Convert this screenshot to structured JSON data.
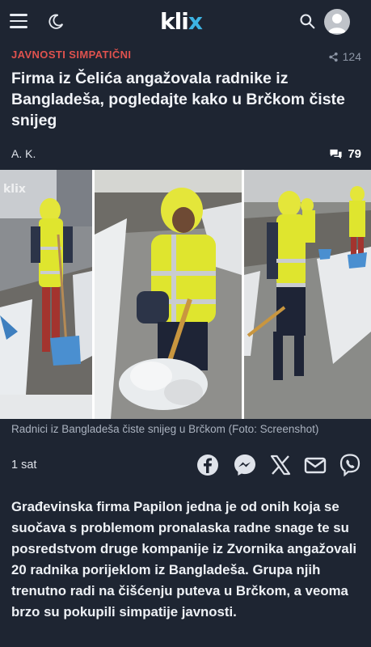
{
  "header": {
    "logo_text": "klix",
    "icons": [
      "hamburger-menu-icon",
      "moon-icon",
      "search-icon",
      "user-avatar-icon"
    ]
  },
  "article": {
    "category": "JAVNOSTI SIMPATIČNI",
    "share_count": "124",
    "title": "Firma iz Čelića angažovala radnike iz Bangladeša, pogledajte kako u Brčkom čiste snijeg",
    "author": "A. K.",
    "comment_count": "79",
    "image_caption": "Radnici iz Bangladeša čiste snijeg u Brčkom (Foto: Screenshot)",
    "image_watermark": "klix",
    "published": "1 sat",
    "share_targets": [
      "facebook-icon",
      "messenger-icon",
      "x-icon",
      "email-icon",
      "viber-icon"
    ],
    "lead": "Građevinska firma Papilon jedna je od onih koja se suočava s problemom pronalaska radne snage te su posredstvom druge kompanije iz Zvornika angažovali 20 radnika porijeklom iz Bangladeša. Grupa njih trenutno radi na čišćenju puteva u Brčkom, a veoma brzo su pokupili simpatije javnosti."
  },
  "colors": {
    "background": "#1e2532",
    "category_red": "#e0524e",
    "logo_x_blue": "#3db3e3"
  }
}
